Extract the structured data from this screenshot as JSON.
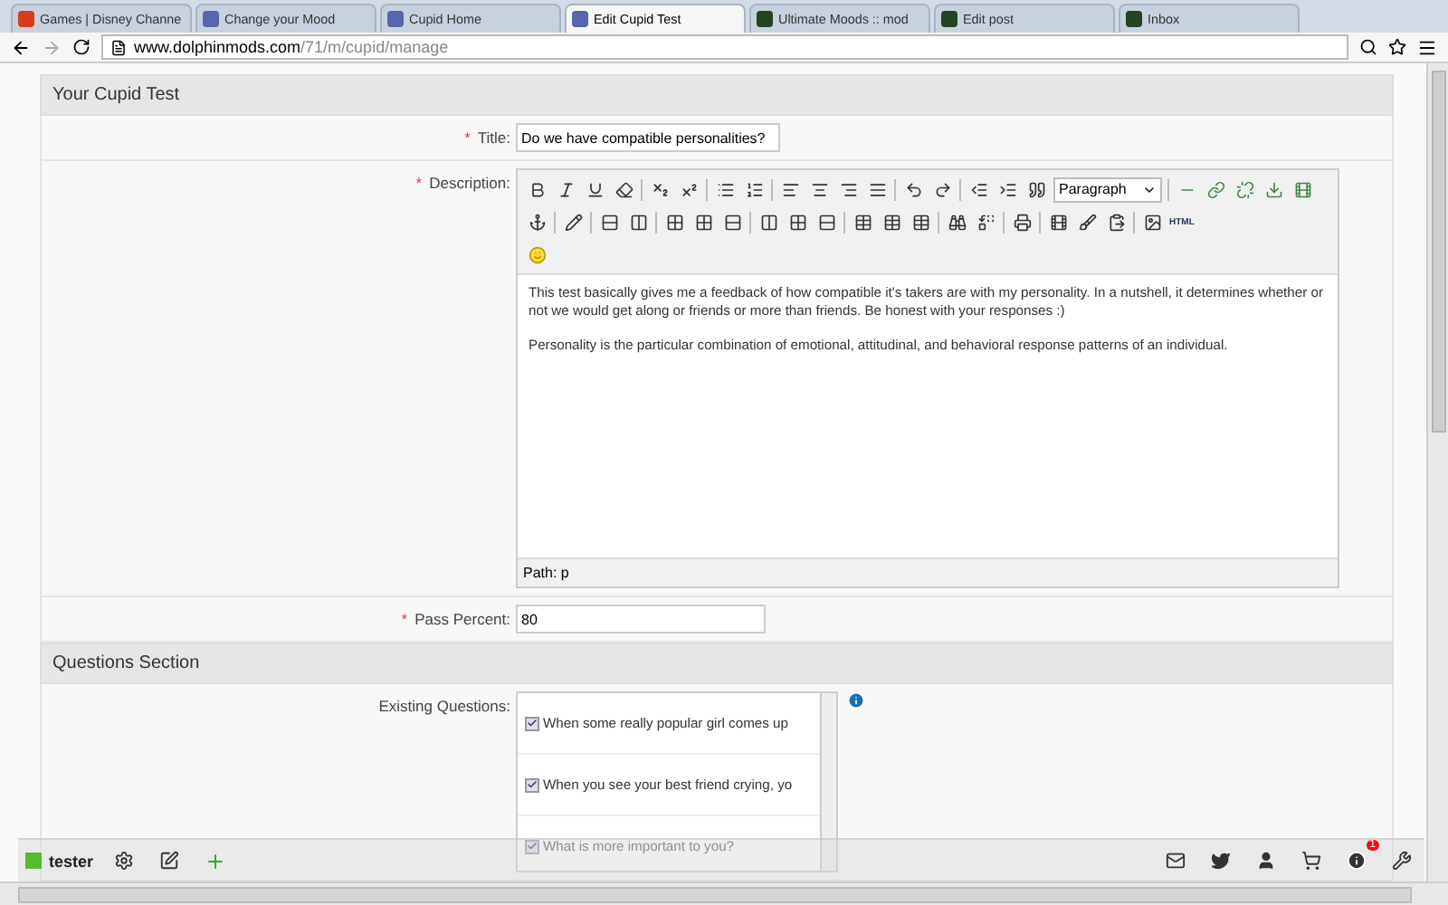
{
  "browser": {
    "tabs": [
      {
        "label": "Games | Disney Channe",
        "selected": false,
        "color": "#d83b1e"
      },
      {
        "label": "Change your Mood",
        "selected": false,
        "color": "#5566aa"
      },
      {
        "label": "Cupid Home",
        "selected": false,
        "color": "#5566aa"
      },
      {
        "label": "Edit Cupid Test",
        "selected": true,
        "color": "#5566aa"
      },
      {
        "label": "Ultimate Moods :: mod",
        "selected": false,
        "color": "#224422"
      },
      {
        "label": "Edit post",
        "selected": false,
        "color": "#224422"
      },
      {
        "label": "Inbox",
        "selected": false,
        "color": "#224422"
      }
    ],
    "url_host": "www.dolphinmods.com",
    "url_path": "/71/m/cupid/manage"
  },
  "form": {
    "section_title": "Your Cupid Test",
    "title_field": {
      "required_mark": "*",
      "label": "Title:",
      "value": "Do we have compatible personalities?"
    },
    "description": {
      "required_mark": "*",
      "label": "Description:",
      "block_format": "Paragraph",
      "html_button": "HTML",
      "paragraphs": [
        "This test basically gives me a feedback of how compatible it's takers are with my personality. In a nutshell, it determines whether or not we would get along or friends or more than friends. Be honest with your responses :)",
        "Personality is the particular combination of emotional, attitudinal, and behavioral response patterns of an individual."
      ],
      "path": "Path: p"
    },
    "pass_percent": {
      "required_mark": "*",
      "label": "Pass Percent:",
      "value": "80"
    },
    "questions_title": "Questions Section",
    "existing_questions": {
      "label": "Existing Questions:",
      "items": [
        {
          "text": "When some really popular girl comes up",
          "checked": true
        },
        {
          "text": "When you see your best friend crying, yo",
          "checked": true
        },
        {
          "text": "What is more important to you?",
          "checked": true
        }
      ]
    }
  },
  "bottom_bar": {
    "user": "tester",
    "notification_count": "1"
  }
}
